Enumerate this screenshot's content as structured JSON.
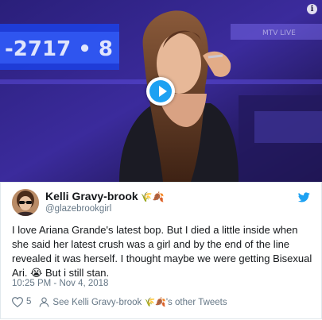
{
  "video": {
    "play_icon": "play-icon",
    "info_icon": "info-icon",
    "info_glyph": "i",
    "colors": {
      "play_accent": "#1da1f2",
      "stage": "#1a1440"
    }
  },
  "tweet": {
    "author_name": "Kelli Gravy-brook",
    "author_emoji": "🌾🍂",
    "handle": "@glazebrookgirl",
    "text_main": "I love Ariana Grande's latest bop. But I died a little inside when she said her latest crush was a girl and by the end of the line revealed it was herself. I thought maybe we were getting Bisexual Ari. ",
    "text_emoji": "😭",
    "text_tail": " But i still stan.",
    "timestamp": "10:25 PM - Nov 4, 2018",
    "likes": "5",
    "see_more_prefix": "See Kelli Gravy-brook ",
    "see_more_emoji": "🌾🍂",
    "see_more_suffix": "'s other Tweets",
    "colors": {
      "bird": "#1da1f2",
      "secondary_text": "#657786",
      "primary_text": "#14171a"
    }
  }
}
